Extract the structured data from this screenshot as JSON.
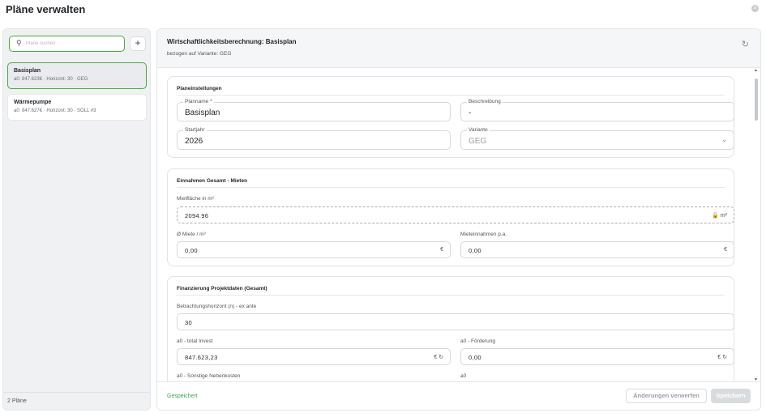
{
  "dialog": {
    "title": "Pläne verwalten",
    "close_icon": "×"
  },
  "sidebar": {
    "search_placeholder": "Pläne suchen",
    "search_icon": "⚲",
    "add_label": "+",
    "plans": [
      {
        "name": "Basisplan",
        "summary": "a0: 847.623€ · Horizont: 30 · GEG",
        "active": true
      },
      {
        "name": "Wärmepumpe",
        "summary": "a0: 847.627€ · Horizont: 30 · SOLL #3",
        "active": false
      }
    ],
    "footer_count": "2 Pläne"
  },
  "header": {
    "title": "Wirtschaftlichkeitsberechnung: Basisplan",
    "subtitle": "bezogen auf Variante: GEG",
    "reset_icon": "↻"
  },
  "section1": {
    "title": "Planeinstellungen",
    "planname_label": "Planname *",
    "planname_value": "Basisplan",
    "beschreibung_label": "Beschreibung",
    "beschreibung_value": "-",
    "startjahr_label": "Startjahr",
    "startjahr_value": "2026",
    "variante_label": "Variante",
    "variante_value": "GEG",
    "chevron": "⌄"
  },
  "section2": {
    "title": "Einnahmen Gesamt - Mieten",
    "mietflaeche_label": "Mietfläche in m²",
    "mietflaeche_value": "2094.96",
    "mietflaeche_unit": "🔒 m²",
    "miete_label": "Ø Miete / m²",
    "miete_value": "0,00",
    "miete_unit": "€",
    "mieteinnahmen_label": "Mieteinnahmen p.a.",
    "mieteinnahmen_value": "0,00",
    "mieteinnahmen_unit": "€"
  },
  "section3": {
    "title": "Finanzierung Projektdaten (Gesamt)",
    "horizont_label": "Betrachtungshorizont (n) - ex ante",
    "horizont_value": "30",
    "invest_label": "a0 - total Invest",
    "invest_value": "847.623,23",
    "invest_unit": "€ ↻",
    "foerderung_label": "a0 - Förderung",
    "foerderung_value": "0,00",
    "foerderung_unit": "€ ↻",
    "nebenkosten_label": "a0 - Sonstige Nebenkosten",
    "a0_label": "a0"
  },
  "scrollbar": {
    "up": "▲",
    "down": "▼"
  },
  "footer": {
    "status": "Gespeichert",
    "discard_label": "Änderungen verwerfen",
    "save_label": "Speichern"
  }
}
